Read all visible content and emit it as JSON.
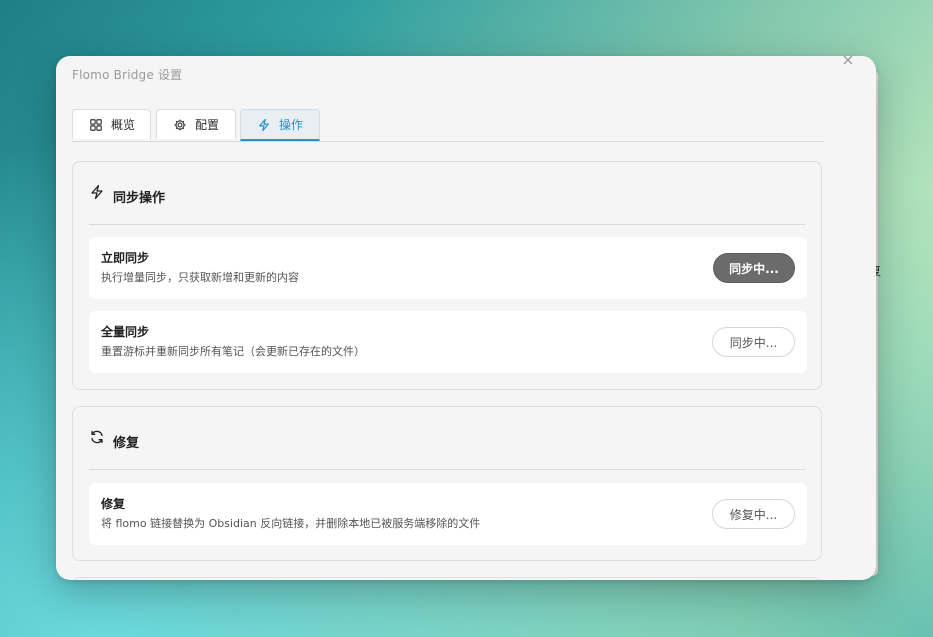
{
  "modal": {
    "title": "Flomo Bridge 设置",
    "close_symbol": "×"
  },
  "tabs": [
    {
      "label": "概览",
      "icon": "dashboard-icon",
      "active": false
    },
    {
      "label": "配置",
      "icon": "gear-icon",
      "active": false
    },
    {
      "label": "操作",
      "icon": "lightning-icon",
      "active": true
    }
  ],
  "sections": {
    "sync": {
      "title": "同步操作",
      "icon": "lightning-icon",
      "rows": [
        {
          "title": "立即同步",
          "desc": "执行增量同步，只获取新增和更新的内容",
          "button": "同步中..."
        },
        {
          "title": "全量同步",
          "desc": "重置游标并重新同步所有笔记（会更新已存在的文件）",
          "button": "同步中..."
        }
      ]
    },
    "repair": {
      "title": "修复",
      "icon": "refresh-icon",
      "rows": [
        {
          "title": "修复",
          "desc": "将 flomo 链接替换为 Obsidian 反向链接，并删除本地已被服务端移除的文件",
          "button": "修复中..."
        }
      ]
    }
  },
  "background_window": {
    "glyph": "复"
  },
  "colors": {
    "accent": "#2a90c6",
    "dark_button": "#6b6b6b",
    "modal_bg": "#f5f5f5"
  }
}
